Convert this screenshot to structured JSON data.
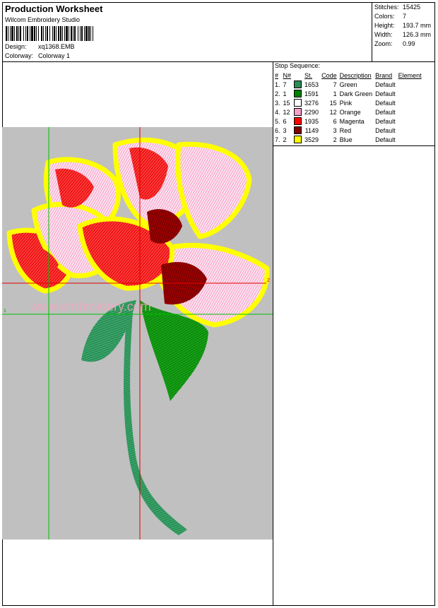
{
  "header": {
    "title": "Production Worksheet",
    "software": "Wilcom Embroidery Studio",
    "design_label": "Design:",
    "design_value": "xq1368.EMB",
    "colorway_label": "Colorway:",
    "colorway_value": "Colorway 1"
  },
  "stats": [
    {
      "label": "Stitches:",
      "value": "15425"
    },
    {
      "label": "Colors:",
      "value": "7"
    },
    {
      "label": "Height:",
      "value": "193.7 mm"
    },
    {
      "label": "Width:",
      "value": "126.3 mm"
    },
    {
      "label": "Zoom:",
      "value": "0.99"
    }
  ],
  "stop_sequence": {
    "title": "Stop Sequence:",
    "columns": [
      "#",
      "N#",
      "St.",
      "Code",
      "Description",
      "Brand",
      "Element"
    ],
    "rows": [
      {
        "num": "1.",
        "n": "7",
        "color": "#2e8b57",
        "st": "1653",
        "code": "7",
        "desc": "Green",
        "brand": "Default"
      },
      {
        "num": "2.",
        "n": "1",
        "color": "#008000",
        "st": "1591",
        "code": "1",
        "desc": "Dark Green",
        "brand": "Default"
      },
      {
        "num": "3.",
        "n": "15",
        "color": "#ffffff",
        "st": "3276",
        "code": "15",
        "desc": "Pink",
        "brand": "Default"
      },
      {
        "num": "4.",
        "n": "12",
        "color": "#f5a0c8",
        "st": "2290",
        "code": "12",
        "desc": "Orange",
        "brand": "Default"
      },
      {
        "num": "5.",
        "n": "6",
        "color": "#ff0000",
        "st": "1935",
        "code": "6",
        "desc": "Magenta",
        "brand": "Default"
      },
      {
        "num": "6.",
        "n": "3",
        "color": "#800000",
        "st": "1149",
        "code": "3",
        "desc": "Red",
        "brand": "Default"
      },
      {
        "num": "7.",
        "n": "2",
        "color": "#ffff00",
        "st": "3529",
        "code": "2",
        "desc": "Blue",
        "brand": "Default"
      }
    ]
  },
  "preview": {
    "background": "#c0c0c0",
    "marker_1": "1",
    "marker_2": "2",
    "watermark": "www.embroidery.com"
  }
}
